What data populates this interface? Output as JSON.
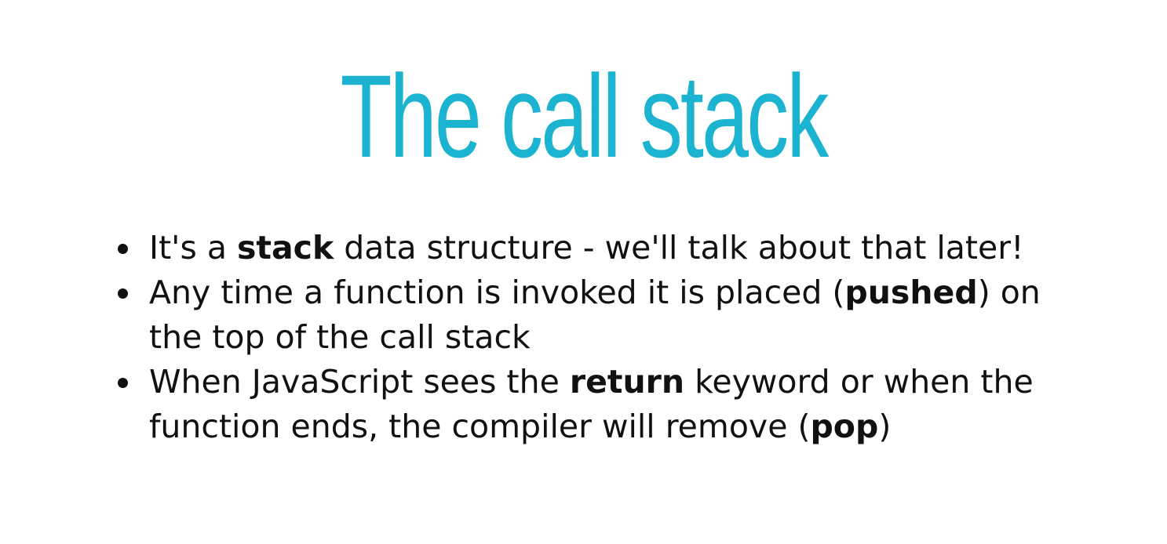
{
  "slide": {
    "title": "The call stack",
    "title_color": "#1bb3cf",
    "bullets": [
      {
        "before": "It's a ",
        "bold": "stack",
        "after": " data structure - we'll talk about that later!"
      },
      {
        "before": "Any time a function is invoked it is placed (",
        "bold": "pushed",
        "after": ") on the top of the call stack"
      },
      {
        "before": "When JavaScript sees the ",
        "bold": "return",
        "after": " keyword or when the function ends, the compiler will remove (",
        "bold2": "pop",
        "after2": ")"
      }
    ]
  }
}
